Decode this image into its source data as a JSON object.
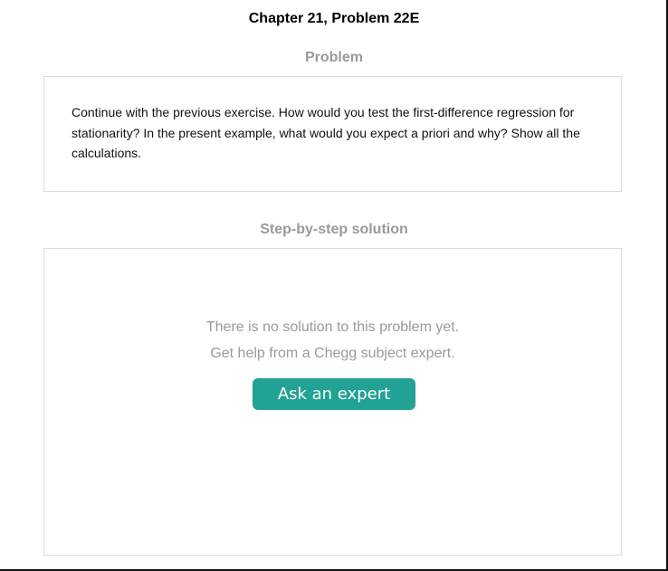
{
  "header": {
    "title": "Chapter 21, Problem 22E"
  },
  "problem": {
    "label": "Problem",
    "text": "Continue with the previous exercise. How would you test the first-difference regression for stationarity? In the present example, what would you expect a priori and why? Show all the calculations."
  },
  "solution": {
    "label": "Step-by-step solution",
    "empty_line1": "There is no solution to this problem yet.",
    "empty_line2": "Get help from a Chegg subject expert.",
    "button_label": "Ask an expert",
    "button_color": "#22a195"
  }
}
